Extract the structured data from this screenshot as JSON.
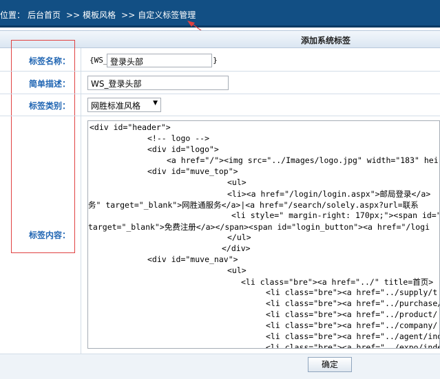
{
  "breadcrumb": {
    "prefix": "位置：",
    "items": [
      "后台首页",
      "模板风格",
      "自定义标签管理"
    ],
    "separator": ">>"
  },
  "panel": {
    "title": "添加系统标签"
  },
  "form": {
    "tag_name": {
      "label": "标签名称：",
      "prefix": "{WS_",
      "value": "登录头部",
      "suffix": "}"
    },
    "description": {
      "label": "简单描述：",
      "value": "WS_登录头部"
    },
    "category": {
      "label": "标签类别：",
      "selected": "网胜标准风格"
    },
    "content": {
      "label": "标签内容：",
      "lines": [
        "<div id=\"header\">",
        "<!-- logo -->",
        "<div id=\"logo\">",
        "<a href=\"/\"><img src=\"../Images/logo.jpg\" width=\"183\" hei",
        "<div id=\"muve_top\">",
        "<ul>",
        "<li><a href=\"/login/login.aspx\">邮局登录</a>",
        "务\" target=\"_blank\">网胜通服务</a>|<a href=\"/search/solely.aspx?url=联系",
        "<li style=\" margin-right: 170px;\"><span id=\"",
        "target=\"_blank\">免费注册</a></span><span id=\"login_button\"><a href=\"/logi",
        "</ul>",
        "</div>",
        "<div id=\"muve_nav\">",
        "<ul>",
        "<li class=\"bre\"><a href=\"../\" title=首页>",
        "<li class=\"bre\"><a href=\"../supply/t",
        "<li class=\"bre\"><a href=\"../purchase/",
        "<li class=\"bre\"><a href=\"../product/",
        "<li class=\"bre\"><a href=\"../company/",
        "<li class=\"bre\"><a href=\"../agent/ind",
        "<li class=\"bre\"><a href=\"../expo/inde"
      ]
    }
  },
  "submit_label": "确定",
  "colors": {
    "topbar": "#124f84",
    "label": "#2166b3",
    "annotation": "#e04040"
  }
}
